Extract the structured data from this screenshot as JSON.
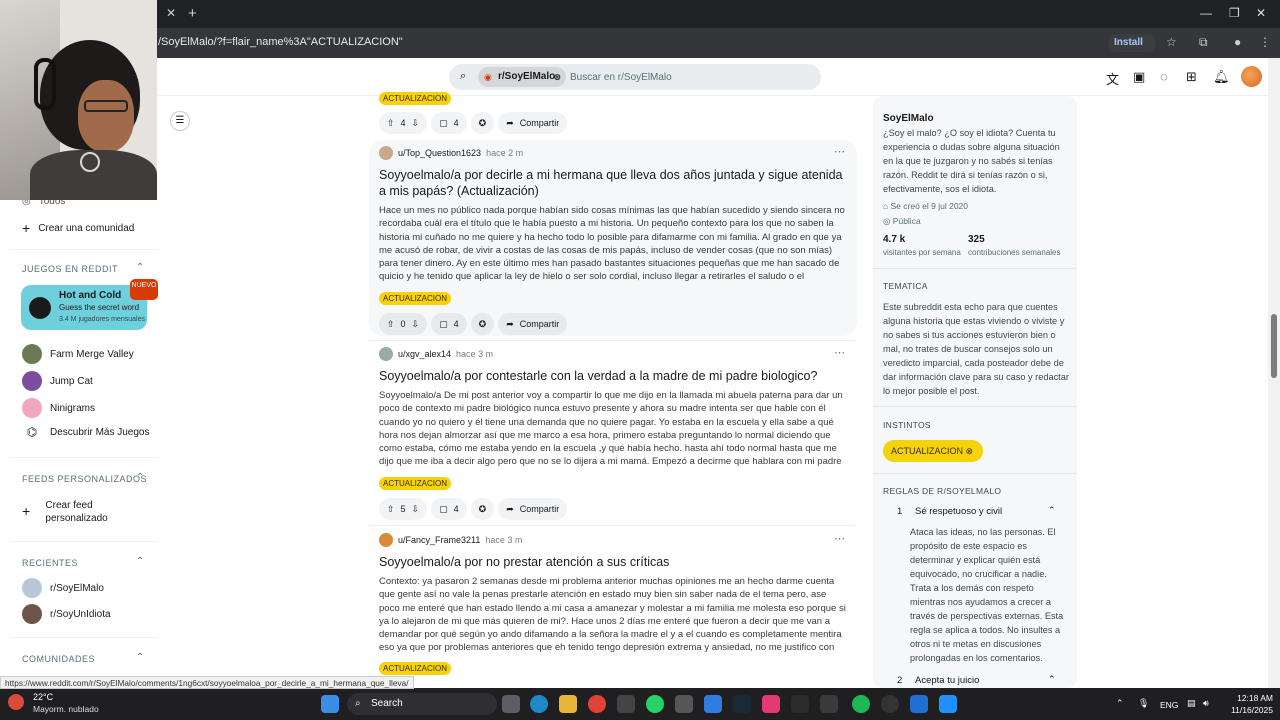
{
  "browser": {
    "url": "/SoyElMalo/?f=flair_name%3A\"ACTUALIZACION\"",
    "install_label": "Install",
    "status_url": "https://www.reddit.com/r/SoyElMalo/comments/1ng6cxt/soyyoelmaloa_por_decirle_a_mi_hermana_que_lleva/"
  },
  "search": {
    "community_chip": "r/SoyElMalo",
    "placeholder": "Buscar en r/SoyElMalo"
  },
  "sidebar": {
    "top_cut_label": "Todos",
    "create_community": "Crear una comunidad",
    "games_heading": "JUEGOS EN REDDIT",
    "featured_game": {
      "title": "Hot and Cold",
      "subtitle": "Guess the secret word",
      "players": "3.4 M jugadores mensuales",
      "badge": "NUEVO"
    },
    "games": [
      {
        "label": "Farm Merge Valley"
      },
      {
        "label": "Jump Cat"
      },
      {
        "label": "Ninigrams"
      },
      {
        "label": "Descubrir Más Juegos"
      }
    ],
    "feeds_heading": "FEEDS PERSONALIZADOS",
    "create_feed": "Crear feed personalizado",
    "recent_heading": "RECIENTES",
    "recent": [
      {
        "label": "r/SoyElMalo"
      },
      {
        "label": "r/SoyUnIdiota"
      }
    ],
    "communities_heading": "COMUNIDADES"
  },
  "feed": {
    "top_flair": "ACTUALIZACION",
    "top_actions": {
      "votes": "4",
      "comments": "4",
      "share": "Compartir"
    },
    "posts": [
      {
        "author": "u/Top_Question1623",
        "time": "hace 2 m",
        "title": "Soyyoelmalo/a por decirle a mi hermana que lleva dos años juntada y sigue atenida a mis papás? (Actualización)",
        "body": "Hace un mes no público nada porque habían sido cosas mínimas las que habían sucedido y siendo sincera no recordaba cuál era el título que le había puesto a mi historia. Un pequeño contexto para los que no saben la historia mi cuñado no me quiere y ha hecho todo lo posible para difamarme con mi familia. Al grado en que ya me acusó de robar, de vivir a costas de las cosas de mis papás, incluso de vender cosas (que no son mías) para tener dinero. Ay en este último mes han pasado bastantes situaciones pequeñas que me han sacado de quicio y he tenido que aplicar la ley de hielo o ser solo cordial, incluso llegar a retirarles el saludo o el hablarles. Bueno...",
        "flair": "ACTUALIZACION",
        "votes": "0",
        "comments": "4",
        "share": "Compartir"
      },
      {
        "author": "u/xgv_alex14",
        "time": "hace 3 m",
        "title": "Soyyoelmalo/a por contestarle con la verdad a la madre de mi padre biologico?",
        "body": "Soyyoelmalo/a De mi post anterior voy a compartir lo que me dijo en la llamada mi abuela paterna para dar un poco de contexto mi padre biológico nunca estuvo presente y ahora su madre intenta ser que hable con él cuando yo no quiero y él tiene una demanda que no quiere pagar. Yo estaba en la escuela y ella sabe a qué hora nos dejan almorzar así que me marco a esa hora, primero estaba preguntando lo normal diciendo que como estaba, cómo me estaba yendo en la escuela ,y qué había hecho. hasta ahí todo normal hasta que me dijo que me iba a decir algo pero que no se lo dijera a mi mamá. Empezó a decirme que hablara con mi padre biológico...",
        "flair": "ACTUALIZACION",
        "votes": "5",
        "comments": "4",
        "share": "Compartir"
      },
      {
        "author": "u/Fancy_Frame3211",
        "time": "hace 3 m",
        "title": "Soyyoelmalo/a por no prestar atención a sus críticas",
        "body": "Contexto: ya pasaron 2 semanas desde mi problema anterior muchas opiniones me an hecho darme cuenta que gente así no vale la penas prestarle atención en estado muy bien sin saber nada de el tema pero, ase poco me enteré que han estado llendo a mi casa a amanezar y molestar a mi familia me molesta eso porque si ya lo alejaron de mi que más quieren de mi?. Hace unos 2 días me enteré que fueron a decir que me van a demandar por qué según yo ando difamando a la señora la madre el y a el cuando es completamente mentira eso ya que por problemas anteriores que eh tenido tengo depresión extrema y ansiedad, no me justifico con eso pero en...",
        "flair": "ACTUALIZACION"
      }
    ]
  },
  "about": {
    "name": "SoyElMalo",
    "description": "¿Soy el malo? ¿O soy el idiota? Cuenta tu experiencia o dudas sobre alguna situación en la que te juzgaron y no sabés si tenías razón. Reddit te dirá si tenías razón o si, efectivamente, sos el idiota.",
    "created": "Se creó el 9 jul 2020",
    "visibility": "Pública",
    "visitors": "4.7 k",
    "visitors_label": "visitantes por semana",
    "contributions": "325",
    "contributions_label": "contribuciones semanales",
    "theme_heading": "TEMATICA",
    "theme_text": "Este subreddit esta echo para que cuentes alguna historia que estas viviendo o viviste y no sabes si tus acciones estuvieron bien o mal, no trates de buscar consejos solo un veredicto imparcial, cada posteador debe de dar información clave para su caso y redactar lo mejor posible el post.",
    "instincts_heading": "INSTINTOS",
    "instinct_flair": "ACTUALIZACION",
    "rules_heading": "REGLAS DE R/SOYELMALO",
    "rules": [
      {
        "num": "1",
        "title": "Sé respetuoso y civil",
        "text": "Ataca las ideas, no las personas. El propósito de este espacio es determinar y explicar quién está equivocado, no crucificar a nadie. Trata a los demás con respeto mientras nos ayudamos a crecer a través de perspectivas externas. Esta regla se aplica a todos. No insultes a otros ni te metas en discusiones prolongadas en los comentarios."
      },
      {
        "num": "2",
        "title": "Acepta tu juicio"
      }
    ]
  },
  "taskbar": {
    "temp": "22°C",
    "weather": "Mayorm. nublado",
    "search_label": "Search",
    "lang": "ENG",
    "time": "12:18 AM",
    "date": "11/16/2025"
  },
  "colors": {
    "flair": "#f5d20c",
    "accent": "#d93a00"
  }
}
